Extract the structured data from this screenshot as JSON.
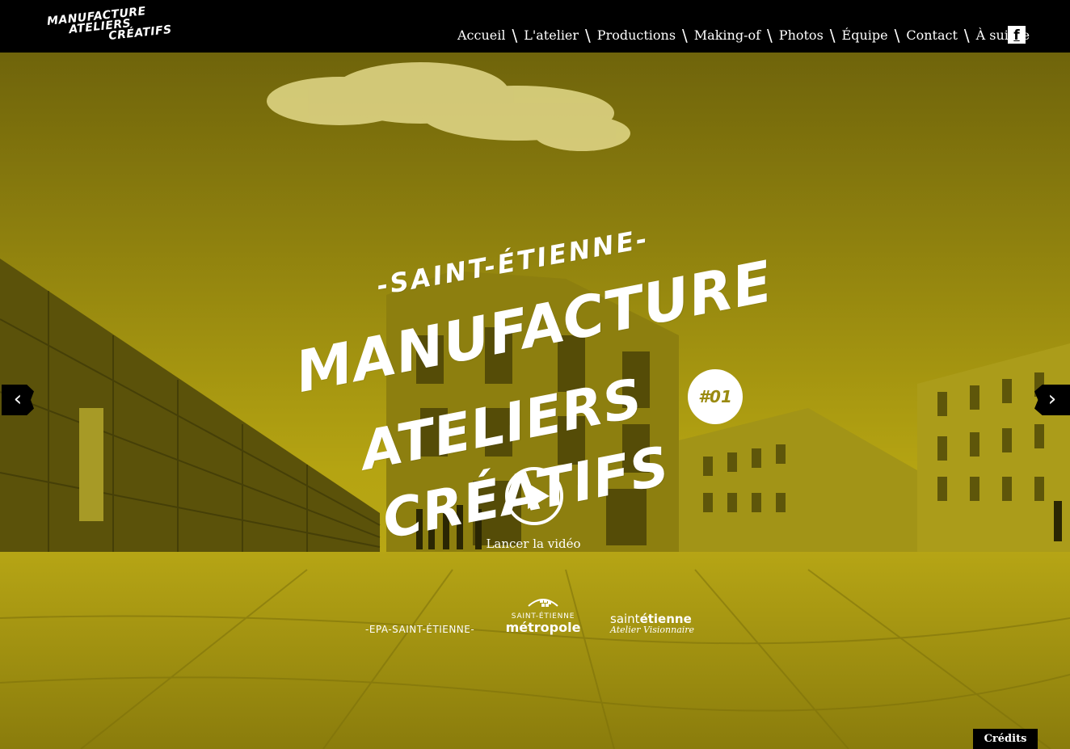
{
  "brand": {
    "logo_lines": [
      "MANUFACTURE",
      "ATELIERS",
      "CRÉATIFS"
    ]
  },
  "nav": {
    "items": [
      {
        "label": "Accueil"
      },
      {
        "label": "L'atelier"
      },
      {
        "label": "Productions"
      },
      {
        "label": "Making-of"
      },
      {
        "label": "Photos"
      },
      {
        "label": "Équipe"
      },
      {
        "label": "Contact"
      },
      {
        "label": "À suivre"
      }
    ],
    "separator": "\\",
    "facebook_icon": "facebook-icon",
    "facebook_glyph": "f"
  },
  "hero": {
    "city": "-SAINT-ÉTIENNE-",
    "title_lines": [
      "MANUFACTURE",
      "ATELIERS",
      "CRÉATIFS"
    ],
    "badge": "#01",
    "play_icon": "play-icon",
    "play_label": "Lancer la vidéo",
    "prev_icon": "chevron-left-icon",
    "prev_glyph": "‹",
    "next_icon": "chevron-right-icon",
    "next_glyph": "›"
  },
  "partners": {
    "epa": "-EPA-SAINT-ÉTIENNE-",
    "metropole_sub": "SAINT-ÉTIENNE",
    "metropole_main": "métropole",
    "se_main_a": "saint",
    "se_main_b": "étienne",
    "se_sub": "Atelier Visionnaire"
  },
  "footer": {
    "credits_label": "Crédits"
  },
  "colors": {
    "tint": "#b3a311",
    "header_bg": "#000000",
    "text": "#ffffff"
  }
}
